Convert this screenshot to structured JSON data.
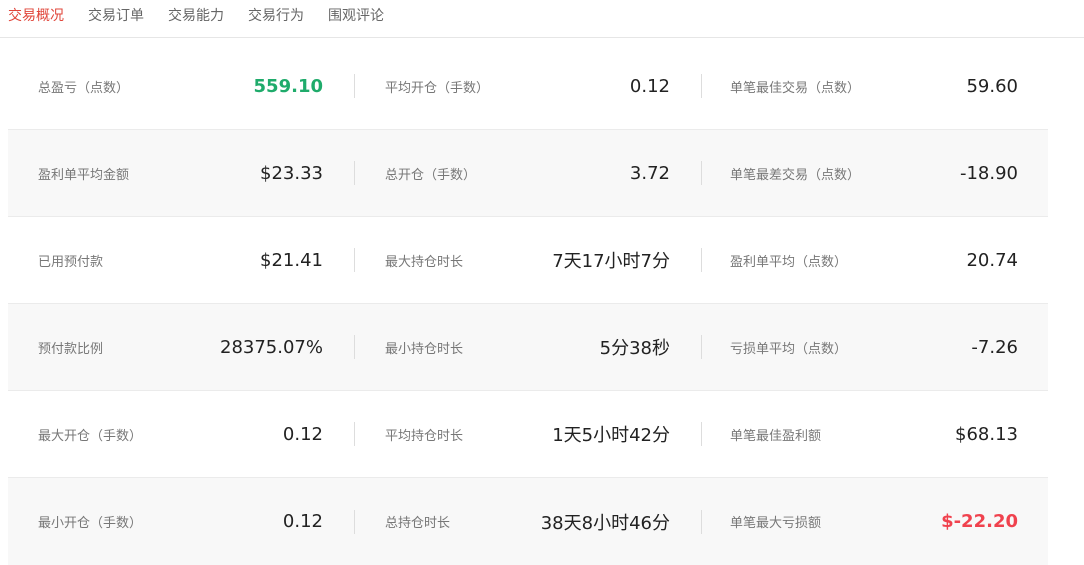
{
  "tabs": [
    {
      "label": "交易概况",
      "active": true
    },
    {
      "label": "交易订单",
      "active": false
    },
    {
      "label": "交易能力",
      "active": false
    },
    {
      "label": "交易行为",
      "active": false
    },
    {
      "label": "围观评论",
      "active": false
    }
  ],
  "colors": {
    "accent": "#e0453a",
    "positive": "#1fab6b",
    "negative": "#f0424e"
  },
  "stats": [
    [
      {
        "label": "总盈亏（点数）",
        "value": "559.10"
      },
      {
        "label": "平均开仓（手数）",
        "value": "0.12"
      },
      {
        "label": "单笔最佳交易（点数）",
        "value": "59.60"
      }
    ],
    [
      {
        "label": "盈利单平均金额",
        "value": "$23.33"
      },
      {
        "label": "总开仓（手数）",
        "value": "3.72"
      },
      {
        "label": "单笔最差交易（点数）",
        "value": "-18.90"
      }
    ],
    [
      {
        "label": "已用预付款",
        "value": "$21.41"
      },
      {
        "label": "最大持仓时长",
        "value": "7天17小时7分"
      },
      {
        "label": "盈利单平均（点数）",
        "value": "20.74"
      }
    ],
    [
      {
        "label": "预付款比例",
        "value": "28375.07%"
      },
      {
        "label": "最小持仓时长",
        "value": "5分38秒"
      },
      {
        "label": "亏损单平均（点数）",
        "value": "-7.26"
      }
    ],
    [
      {
        "label": "最大开仓（手数）",
        "value": "0.12"
      },
      {
        "label": "平均持仓时长",
        "value": "1天5小时42分"
      },
      {
        "label": "单笔最佳盈利额",
        "value": "$68.13"
      }
    ],
    [
      {
        "label": "最小开仓（手数）",
        "value": "0.12"
      },
      {
        "label": "总持仓时长",
        "value": "38天8小时46分"
      },
      {
        "label": "单笔最大亏损额",
        "value": "$-22.20"
      }
    ]
  ]
}
